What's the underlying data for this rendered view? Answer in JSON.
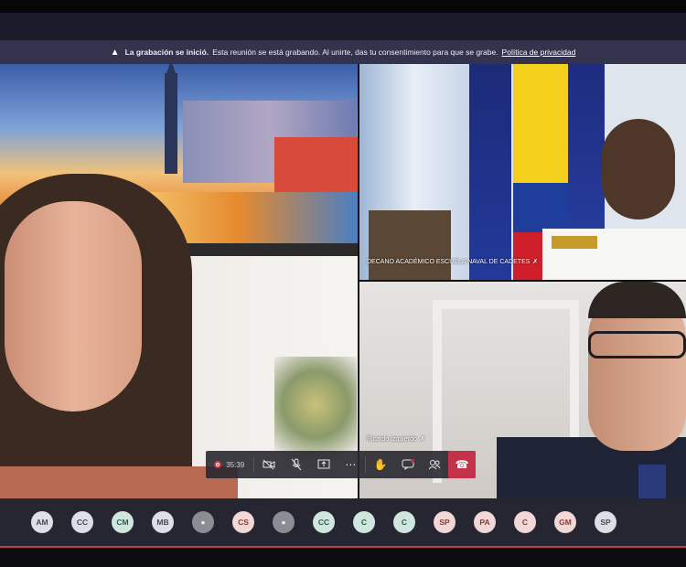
{
  "banner": {
    "icon": "warning-icon",
    "bold_text": "La grabación se inició.",
    "text": "Esta reunión se está grabando. Al unirte, das tu consentimiento para que se grabe.",
    "link": "Política de privacidad"
  },
  "tiles": {
    "top_right_label": "DECANO ACADÉMICO ESCUELA NAVAL DE CADETES",
    "bottom_right_label": "Ricardo Izquierdo"
  },
  "controls": {
    "timer": "35:39",
    "icons": [
      "record-icon",
      "camera-off-icon",
      "mic-off-icon",
      "share-icon",
      "more-icon",
      "raise-hand-icon",
      "chat-icon",
      "participants-icon",
      "hang-up-icon"
    ]
  },
  "participants": [
    {
      "initials": "AM",
      "style": "default"
    },
    {
      "initials": "CC",
      "style": "default"
    },
    {
      "initials": "CM",
      "style": "teal"
    },
    {
      "initials": "MB",
      "style": "default"
    },
    {
      "initials": "",
      "style": "gray"
    },
    {
      "initials": "CS",
      "style": "pink"
    },
    {
      "initials": "",
      "style": "gray"
    },
    {
      "initials": "CC",
      "style": "teal"
    },
    {
      "initials": "C",
      "style": "teal"
    },
    {
      "initials": "C",
      "style": "teal"
    },
    {
      "initials": "SP",
      "style": "pink"
    },
    {
      "initials": "PA",
      "style": "pink"
    },
    {
      "initials": "C",
      "style": "pink"
    },
    {
      "initials": "GM",
      "style": "pink"
    },
    {
      "initials": "SP",
      "style": "default"
    }
  ],
  "colors": {
    "accent": "#c4314b",
    "banner": "#33334d",
    "strip": "#262633"
  }
}
